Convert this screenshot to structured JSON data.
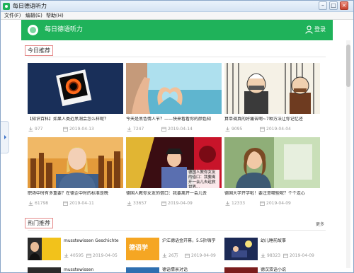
{
  "window": {
    "title": "每日德语听力",
    "buttons": {
      "minimize": "–",
      "maximize": "□",
      "close": "×"
    }
  },
  "menu": {
    "items": [
      "文件(F)",
      "编辑(E)",
      "帮助(H)"
    ]
  },
  "header": {
    "app_name": "每日德语听力",
    "login_label": "登录",
    "brand_color": "#1fb25a"
  },
  "today": {
    "section_label": "今日推荐",
    "cards": [
      {
        "title": "【知识百科】如果人类近黑洞会怎么样呢？",
        "count": "977",
        "date": "2019-04-13",
        "thumb": "black-hole"
      },
      {
        "title": "今天是黑色情人节？——快来看看你的颜色知",
        "count": "7247",
        "date": "2019-04-14",
        "thumb": "heart-hands"
      },
      {
        "title": "算单调真的好痛苦啊~7种方法让你记忆还",
        "count": "9095",
        "date": "2019-04-04",
        "thumb": "cartoon-prison"
      },
      {
        "title": "职场中时有多重要？在德企中时的标准是晚",
        "count": "61798",
        "date": "2019-04-11",
        "thumb": "news-anchor"
      },
      {
        "title": "德国人教你女友的借口：我要离开一会儿去",
        "count": "33657",
        "date": "2019-04-09",
        "thumb": "voice-singer",
        "overlay_text": "德国人教你女友的借口：我要离开一会儿去趁救世界..."
      },
      {
        "title": "德国大学开学啦！要注意哪些呢？个个走心",
        "count": "12333",
        "date": "2019-04-09",
        "thumb": "student-girl"
      }
    ]
  },
  "hot": {
    "section_label": "热门推荐",
    "more_label": "更多",
    "items": [
      {
        "title": "musstewissen Geschichte",
        "count": "40595",
        "date": "2019-04-05",
        "thumb": "presenter-yellow"
      },
      {
        "title": "沪江德语金开幕，5.5折嗨学",
        "count": "26万",
        "date": "2019-04-09",
        "thumb": "promo-learn",
        "thumb_text": "德语学"
      },
      {
        "title": "幼儿睡前故事",
        "count": "98323",
        "date": "2019-04-09",
        "thumb": "kids-story"
      }
    ],
    "bottom_row": [
      "musstewissen",
      "德语情景对话",
      "德汉双语小说"
    ]
  }
}
